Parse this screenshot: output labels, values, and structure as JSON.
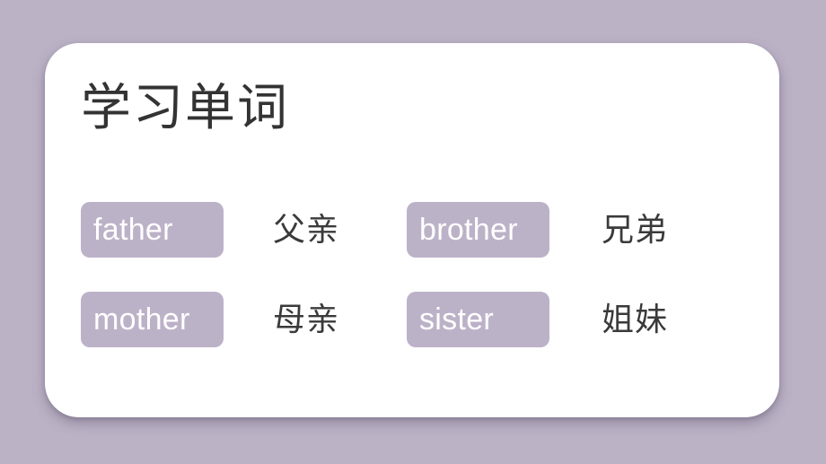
{
  "slide": {
    "title": "学习单词",
    "background_color": "#bcb2c6",
    "card_color": "#ffffff",
    "chip_color": "#bcb2c8",
    "chip_text_color": "#ffffff",
    "gloss_text_color": "#3a3a3a",
    "title_text_color": "#333333"
  },
  "word_rows": [
    {
      "left": {
        "word": "father",
        "gloss": "父亲"
      },
      "right": {
        "word": "brother",
        "gloss": "兄弟"
      }
    },
    {
      "left": {
        "word": "mother",
        "gloss": "母亲"
      },
      "right": {
        "word": "sister",
        "gloss": "姐妹"
      }
    }
  ]
}
